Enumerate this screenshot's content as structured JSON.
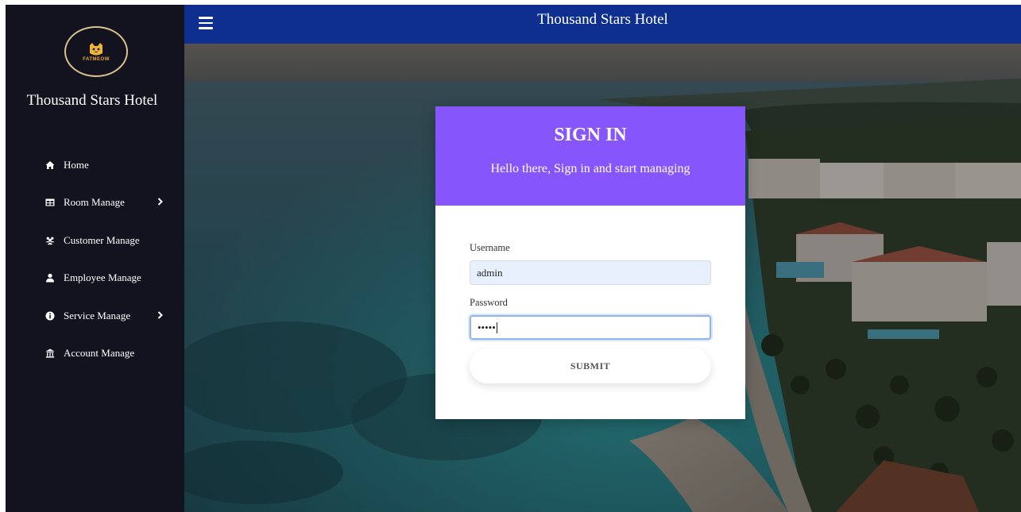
{
  "app": {
    "title": "Thousand Stars Hotel",
    "logo_text": "FATMEOW",
    "brand_name": "Thousand Stars Hotel"
  },
  "sidebar": {
    "items": [
      {
        "label": "Home",
        "icon": "home-icon",
        "has_submenu": false
      },
      {
        "label": "Room Manage",
        "icon": "table-icon",
        "has_submenu": true
      },
      {
        "label": "Customer Manage",
        "icon": "users-icon",
        "has_submenu": false
      },
      {
        "label": "Employee Manage",
        "icon": "user-icon",
        "has_submenu": false
      },
      {
        "label": "Service Manage",
        "icon": "info-circle-icon",
        "has_submenu": true
      },
      {
        "label": "Account Manage",
        "icon": "bank-icon",
        "has_submenu": false
      }
    ]
  },
  "header": {
    "menu_icon": "hamburger-menu-icon",
    "title": "Thousand Stars Hotel"
  },
  "signin": {
    "heading": "SIGN IN",
    "subtitle": "Hello there, Sign in and start managing",
    "username_label": "Username",
    "username_value": "admin",
    "password_label": "Password",
    "password_masked": "•••••",
    "submit_label": "SUBMIT"
  },
  "colors": {
    "sidebar_bg": "#131320",
    "topbar_bg": "#0e2f8f",
    "card_header": "#8655fb",
    "logo_accent": "#e9a935"
  }
}
